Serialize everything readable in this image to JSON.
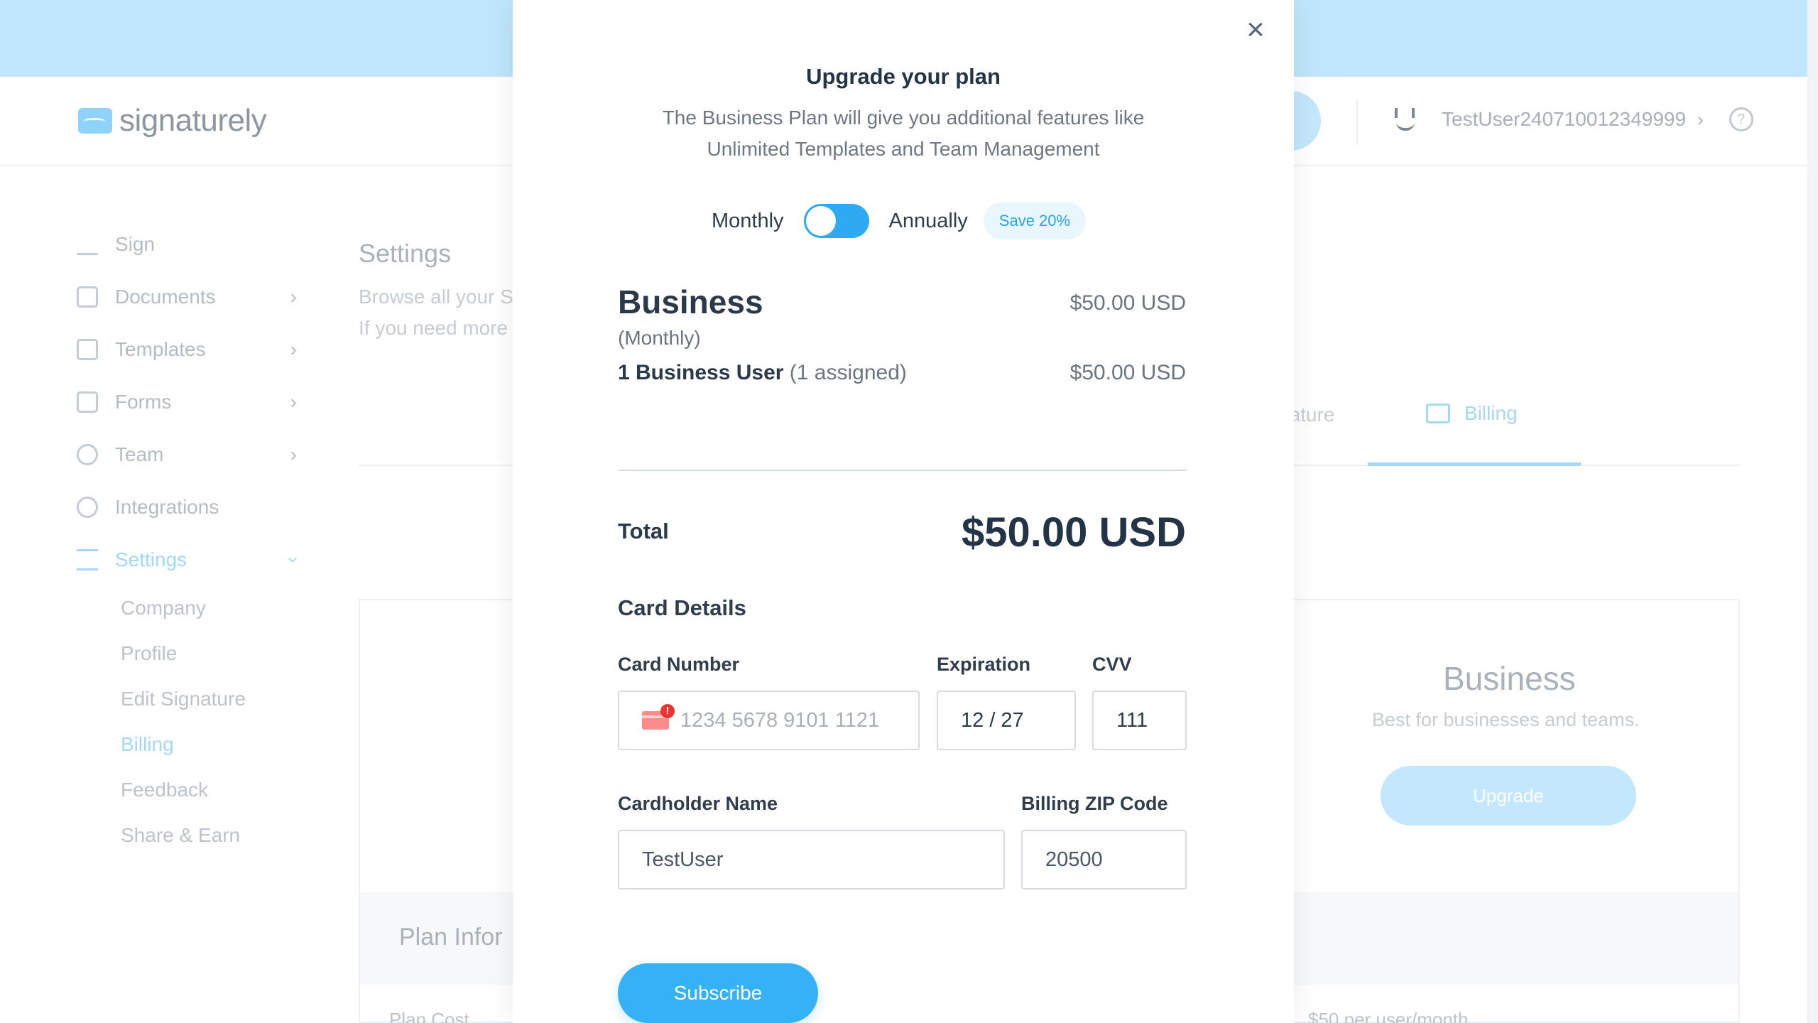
{
  "app": {
    "logo_text": "signaturely",
    "username": "TestUser240710012349999"
  },
  "sidebar": {
    "items": [
      {
        "label": "Sign",
        "icon": "signature-icon"
      },
      {
        "label": "Documents",
        "icon": "document-icon"
      },
      {
        "label": "Templates",
        "icon": "template-icon"
      },
      {
        "label": "Forms",
        "icon": "form-icon"
      },
      {
        "label": "Team",
        "icon": "user-icon"
      },
      {
        "label": "Integrations",
        "icon": "gear-icon"
      },
      {
        "label": "Settings",
        "icon": "sliders-icon"
      }
    ],
    "settings_sub": [
      "Company",
      "Profile",
      "Edit Signature",
      "Billing",
      "Feedback",
      "Share & Earn"
    ]
  },
  "settings": {
    "title": "Settings",
    "desc_line1": "Browse all your S",
    "desc_line2": "If you need more",
    "tab_partial": "nature",
    "tab_billing": "Billing"
  },
  "plan_card": {
    "name": "Business",
    "desc": "Best for businesses and teams.",
    "upgrade": "Upgrade",
    "info_title": "Plan Infor",
    "cost_label": "Plan Cost",
    "price_text": "$50 per user/month"
  },
  "modal": {
    "title": "Upgrade your plan",
    "subtitle_line1": "The Business Plan will give you additional features like",
    "subtitle_line2": "Unlimited Templates and Team Management",
    "toggle": {
      "left": "Monthly",
      "right": "Annually",
      "badge": "Save 20%"
    },
    "plan": {
      "name": "Business",
      "price": "$50.00 USD",
      "period": "(Monthly)",
      "users_label": "1 Business User",
      "users_assigned": "(1 assigned)",
      "users_price": "$50.00 USD"
    },
    "total": {
      "label": "Total",
      "value": "$50.00 USD"
    },
    "card": {
      "heading": "Card Details",
      "number_label": "Card Number",
      "number_placeholder": "1234 5678 9101 1121",
      "exp_label": "Expiration",
      "exp_value": "12 / 27",
      "cvv_label": "CVV",
      "cvv_value": "111",
      "name_label": "Cardholder Name",
      "name_value": "TestUser",
      "zip_label": "Billing ZIP Code",
      "zip_value": "20500"
    },
    "subscribe": "Subscribe"
  },
  "colors": {
    "accent": "#35b1f6",
    "topbar": "#bfe6fc",
    "error": "#e33333"
  }
}
